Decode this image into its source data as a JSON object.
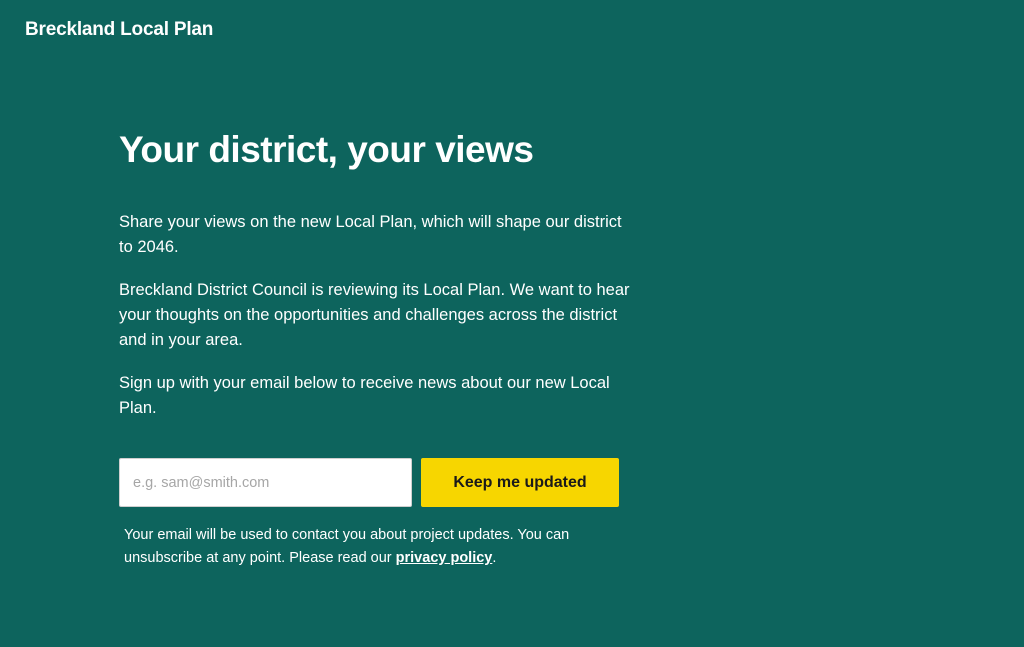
{
  "header": {
    "brand": "Breckland Local Plan"
  },
  "main": {
    "title": "Your district, your views",
    "paragraphs": [
      "Share your views on the new Local Plan, which will shape our district to 2046.",
      "Breckland District Council is reviewing its Local Plan. We want to hear your thoughts on the opportunities and challenges across the district and in your area.",
      "Sign up with your email below to receive news about our new Local Plan."
    ]
  },
  "signup": {
    "email_placeholder": "e.g. sam@smith.com",
    "email_value": "",
    "button_label": "Keep me updated"
  },
  "privacy_note": {
    "text_before": "Your email will be used to contact you about project updates. You can unsubscribe at any point. Please read our ",
    "link_text": "privacy policy",
    "text_after": "."
  },
  "colors": {
    "background": "#0d645d",
    "button": "#f7d600",
    "text": "#ffffff"
  }
}
